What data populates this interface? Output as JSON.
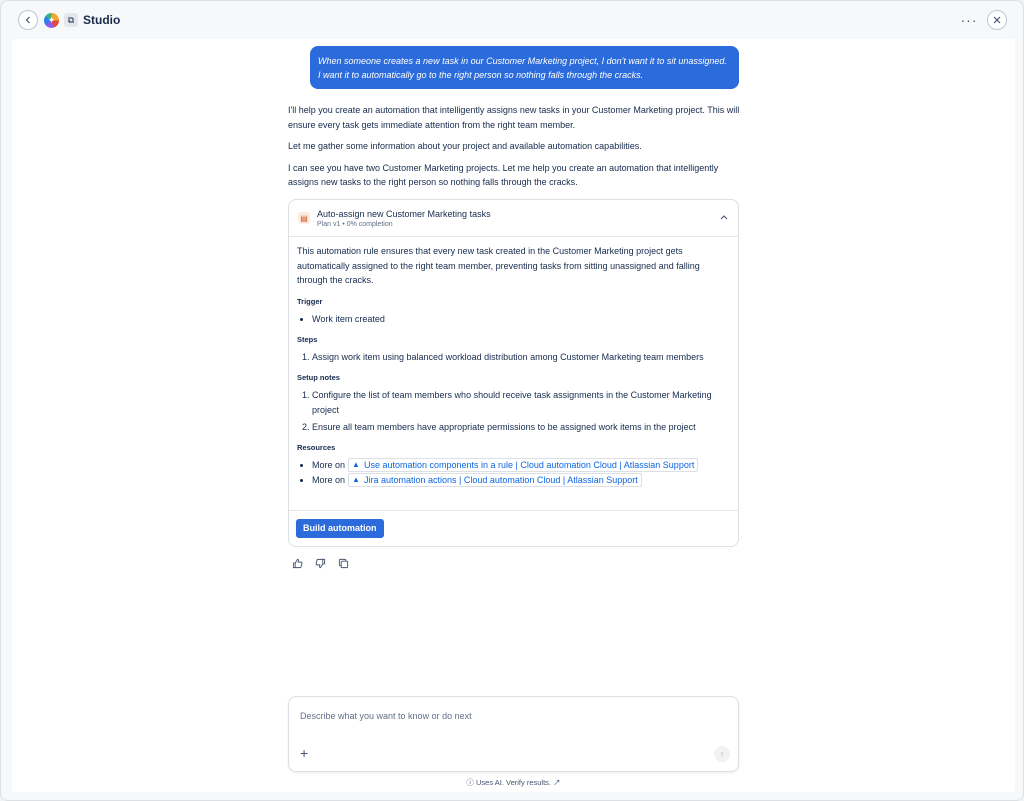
{
  "app": {
    "title": "Studio"
  },
  "conversation": {
    "user_message": "When someone creates a new task in our Customer Marketing project, I don't want it to sit unassigned. I want it to automatically go to the right person so nothing falls through the cracks.",
    "assistant_paragraphs": [
      "I'll help you create an automation that intelligently assigns new tasks in your Customer Marketing project. This will ensure every task gets immediate attention from the right team member.",
      "Let me gather some information about your project and available automation capabilities.",
      "I can see you have two Customer Marketing projects. Let me help you create an automation that intelligently assigns new tasks to the right person so nothing falls through the cracks."
    ]
  },
  "plan": {
    "title": "Auto-assign new Customer Marketing tasks",
    "subtitle": "Plan v1 • 0% completion",
    "description": "This automation rule ensures that every new task created in the Customer Marketing project gets automatically assigned to the right team member, preventing tasks from sitting unassigned and falling through the cracks.",
    "trigger_title": "Trigger",
    "trigger_items": [
      "Work item created"
    ],
    "steps_title": "Steps",
    "steps": [
      "Assign work item using balanced workload distribution among Customer Marketing team members"
    ],
    "setup_title": "Setup notes",
    "setup_notes": [
      "Configure the list of team members who should receive task assignments in the Customer Marketing project",
      "Ensure all team members have appropriate permissions to be assigned work items in the project"
    ],
    "resources_title": "Resources",
    "resources": [
      {
        "prefix": "More on",
        "link": "Use automation components in a rule | Cloud automation Cloud | Atlassian Support"
      },
      {
        "prefix": "More on",
        "link": "Jira automation actions | Cloud automation Cloud | Atlassian Support"
      }
    ],
    "build_button": "Build automation"
  },
  "composer": {
    "placeholder": "Describe what you want to know or do next"
  },
  "disclaimer": "Uses AI. Verify results.",
  "accent_color": "#2c6bdb"
}
